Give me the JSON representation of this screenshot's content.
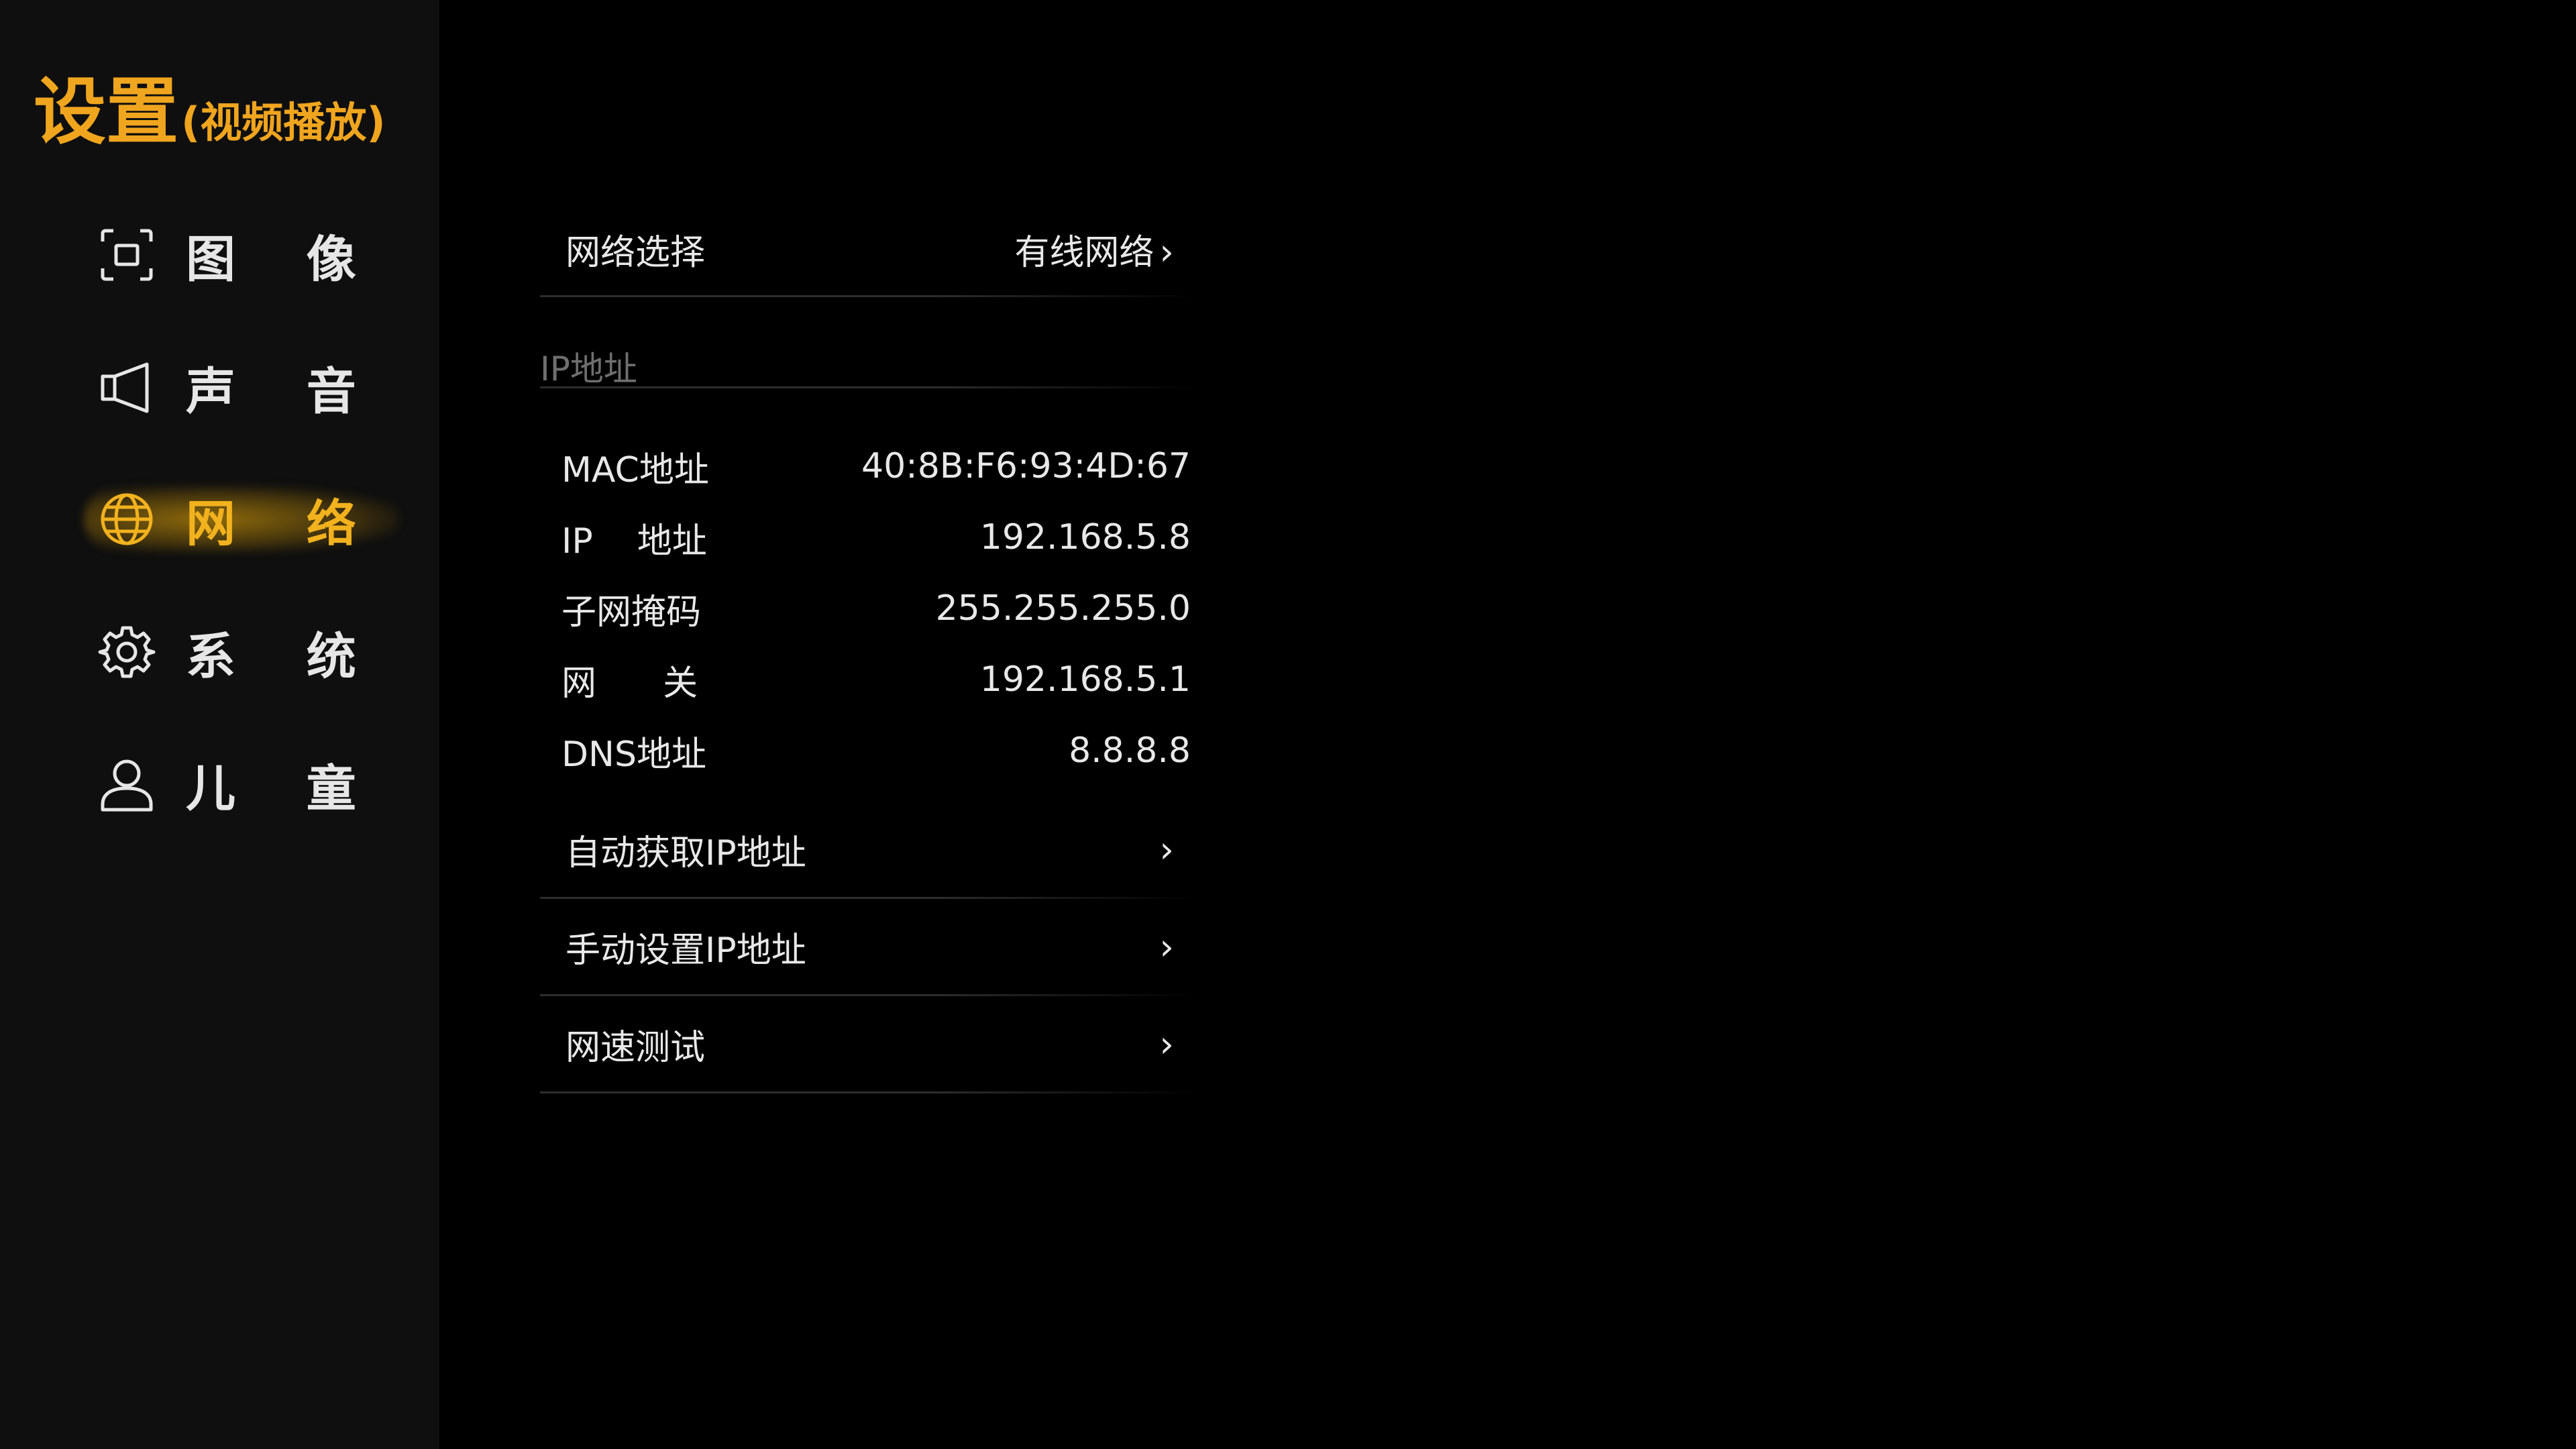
{
  "title": {
    "main": "设置",
    "sub": "(视频播放)"
  },
  "accent_color": "#f0a51e",
  "sidebar": {
    "items": [
      {
        "label": "图 像",
        "icon": "screen-frame-icon",
        "active": false
      },
      {
        "label": "声 音",
        "icon": "speaker-icon",
        "active": false
      },
      {
        "label": "网 络",
        "icon": "globe-icon",
        "active": true
      },
      {
        "label": "系 统",
        "icon": "gear-icon",
        "active": false
      },
      {
        "label": "儿 童",
        "icon": "person-icon",
        "active": false
      }
    ]
  },
  "network": {
    "selection": {
      "label": "网络选择",
      "value": "有线网络",
      "chevron": "›"
    },
    "section_label": "IP地址",
    "info": [
      {
        "label": "MAC地址",
        "value": "40:8B:F6:93:4D:67"
      },
      {
        "label": "IP    地址",
        "value": "192.168.5.8"
      },
      {
        "label": "子网掩码",
        "value": "255.255.255.0"
      },
      {
        "label": "网      关",
        "value": "192.168.5.1"
      },
      {
        "label": "DNS地址",
        "value": "8.8.8.8"
      }
    ],
    "actions": [
      {
        "label": "自动获取IP地址",
        "chevron": "›"
      },
      {
        "label": "手动设置IP地址",
        "chevron": "›"
      },
      {
        "label": "网速测试",
        "chevron": "›"
      }
    ]
  }
}
